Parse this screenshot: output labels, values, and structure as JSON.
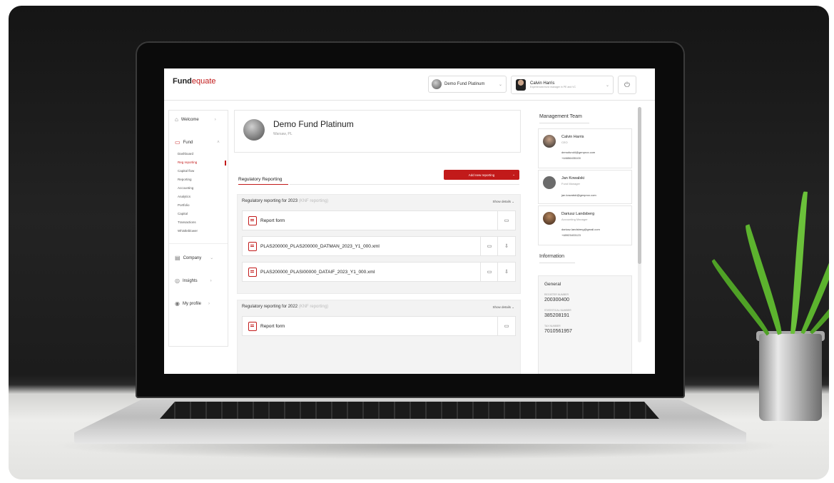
{
  "app": {
    "logo_main": "Fund",
    "logo_accent": "equate"
  },
  "header": {
    "fund_selector": "Demo Fund Platinum",
    "user_name": "Calvin Harris",
    "user_subtitle": "Experienced fund manager in PE and VC"
  },
  "sidebar": {
    "welcome": "Welcome",
    "fund": "Fund",
    "fund_items": [
      "Dashboard",
      "Reg reporting",
      "Capital flow",
      "Reporting",
      "Accounting",
      "Analytics",
      "Portfolio",
      "Capital",
      "Transactions",
      "Whistleblower"
    ],
    "company": "Company",
    "insights": "Insights",
    "my_profile": "My profile"
  },
  "fund": {
    "name": "Demo Fund Platinum",
    "location": "Warsaw, PL"
  },
  "reporting": {
    "tab_label": "Regulatory Reporting",
    "add_button": "Add new reporting",
    "sections": [
      {
        "title": "Regulatory reporting for 2023",
        "title_suffix": "(KNF reporting)",
        "show_details": "Show details",
        "rows": [
          "Report form",
          "PLAS200000_PLAS200000_DATMAN_2023_Y1_000.xml",
          "PLAS200000_PLASI00000_DATAIF_2023_Y1_000.xml"
        ]
      },
      {
        "title": "Regulatory reporting for 2022",
        "title_suffix": "(KNF reporting)",
        "show_details": "Show details",
        "rows": [
          "Report form"
        ]
      }
    ]
  },
  "management": {
    "title": "Management Team",
    "members": [
      {
        "name": "Calvin Harris",
        "role": "CEO",
        "email": "demofund4@genprox.com",
        "phone": "+44656435100"
      },
      {
        "name": "Jan Kowalski",
        "role": "Fund Manager",
        "email": "jan.kowalski@genprox.com",
        "phone": ""
      },
      {
        "name": "Dariusz Landsberg",
        "role": "Accounting Manager",
        "email": "dariusz.landsberg@gmail.com",
        "phone": "+48923403123"
      }
    ]
  },
  "information": {
    "title": "Information",
    "general": "General",
    "register_label": "REGISTER NUMBER",
    "register_value": "200300400",
    "statistical_label": "STATISTICAL NUMBER",
    "statistical_value": "385208191",
    "tax_label": "TAX NUMBER",
    "tax_value": "7010561957"
  },
  "colors": {
    "accent": "#c21a1a",
    "background": "#1c1c1c"
  }
}
